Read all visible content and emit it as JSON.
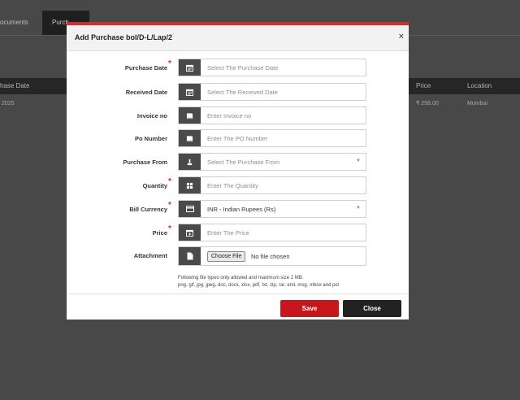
{
  "background": {
    "tabs": [
      "ocuments",
      "Purch"
    ],
    "table_headers": [
      "hase Date",
      "Price",
      "Location"
    ],
    "table_row": [
      "2025",
      "₹ 258.00",
      "Mumbai"
    ]
  },
  "modal": {
    "title": "Add Purchase bol/D-L/Lap/2",
    "close": "×",
    "fields": {
      "purchase_date": {
        "label": "Purchase Date",
        "required": "*",
        "placeholder": "Select The Purchase Date",
        "icon": "calendar-icon"
      },
      "received_date": {
        "label": "Received Date",
        "placeholder": "Select The Received Date",
        "icon": "calendar-icon"
      },
      "invoice_no": {
        "label": "Invoice no",
        "placeholder": "Enter Invoice no",
        "icon": "book-icon"
      },
      "po_number": {
        "label": "Po Number",
        "placeholder": "Enter The PO Number",
        "icon": "book-icon"
      },
      "purchase_from": {
        "label": "Purchase From",
        "placeholder": "Select The Purchase From",
        "icon": "user-icon"
      },
      "quantity": {
        "label": "Quantity",
        "required": "*",
        "placeholder": "Enter The Quantity",
        "icon": "grid-icon"
      },
      "bill_currency": {
        "label": "Bill Currency",
        "required": "*",
        "value": "INR - Indian Rupees (Rs)",
        "icon": "card-icon"
      },
      "price": {
        "label": "Price",
        "required": "*",
        "placeholder": "Enter The Price",
        "icon": "calendar-plus-icon"
      },
      "attachment": {
        "label": "Attachment",
        "button": "Choose File",
        "status": "No file chosen",
        "icon": "file-icon"
      }
    },
    "hint_line1": "Following file types only allowed and maximum size 2 MB:",
    "hint_line2": "png, gif, jpg, jpeg, doc, docx, xlsx, pdf, txt, zip, rar, eml, msg, mbox and pst",
    "save_label": "Save",
    "close_label": "Close"
  },
  "colors": {
    "accent": "#c8161d",
    "addon": "#4a4a4a",
    "dark_button": "#222222"
  }
}
